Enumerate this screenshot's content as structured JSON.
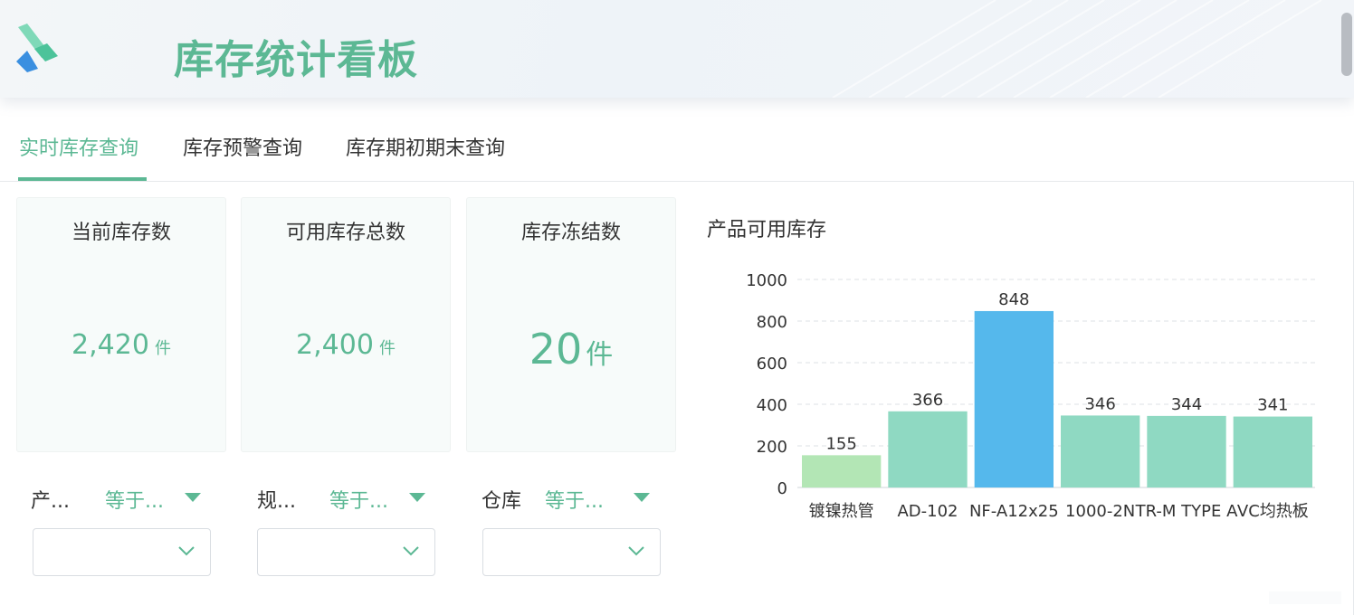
{
  "header": {
    "title": "库存统计看板",
    "logo_icon": "logo-icon"
  },
  "tabs": [
    {
      "label": "实时库存查询",
      "active": true
    },
    {
      "label": "库存预警查询",
      "active": false
    },
    {
      "label": "库存期初期末查询",
      "active": false
    }
  ],
  "cards": [
    {
      "title": "当前库存数",
      "value": "2,420",
      "unit": "件"
    },
    {
      "title": "可用库存总数",
      "value": "2,400",
      "unit": "件"
    },
    {
      "title": "库存冻结数",
      "value": "20",
      "unit": "件"
    }
  ],
  "filters": [
    {
      "label": "产...",
      "operator": "等于...",
      "value": ""
    },
    {
      "label": "规...",
      "operator": "等于...",
      "value": ""
    },
    {
      "label": "仓库",
      "operator": "等于...",
      "value": ""
    }
  ],
  "colors": {
    "accent": "#5cb894",
    "bar_default": "#8fd9c2",
    "bar_highlight": "#55b8ec",
    "bar_low": "#b3e6b5"
  },
  "chart_data": {
    "type": "bar",
    "title": "产品可用库存",
    "categories": [
      "镀镍热管",
      "AD-102",
      "NF-A12x25",
      "1000-2N",
      "TR-M TYPE A",
      "VC均热板"
    ],
    "values": [
      155,
      366,
      848,
      346,
      344,
      341
    ],
    "bar_colors": [
      "#b3e6b5",
      "#8fd9c2",
      "#55b8ec",
      "#8fd9c2",
      "#8fd9c2",
      "#8fd9c2"
    ],
    "ylim": [
      0,
      1000
    ],
    "yticks": [
      0,
      200,
      400,
      600,
      800,
      1000
    ],
    "grid": true,
    "xlabel": "",
    "ylabel": ""
  }
}
